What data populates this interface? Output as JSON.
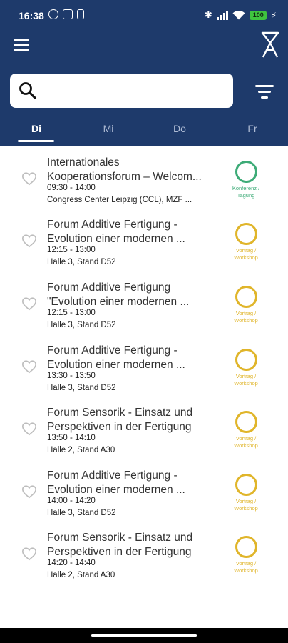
{
  "status_bar": {
    "time": "16:38",
    "battery": "100"
  },
  "header": {
    "menu_icon": "hamburger-menu-icon",
    "logo_icon": "leipzig-fair-logo-icon",
    "filter_icon": "filter-icon",
    "colors": {
      "background": "#1e3a6b",
      "accent": "#ffffff"
    }
  },
  "search": {
    "icon": "search-icon",
    "value": "",
    "placeholder": ""
  },
  "tabs": [
    {
      "label": "Di",
      "active": true
    },
    {
      "label": "Mi",
      "active": false
    },
    {
      "label": "Do",
      "active": false
    },
    {
      "label": "Fr",
      "active": false
    }
  ],
  "events": [
    {
      "title_line1": "Internationales",
      "title_line2": "Kooperationsforum – Welcom...",
      "time": "09:30 - 14:00",
      "location": " Congress Center Leipzig (CCL), MZF ...",
      "type_line1": "Konferenz /",
      "type_line2": "Tagung",
      "type_color": "#3dab77"
    },
    {
      "title_line1": "Forum Additive Fertigung -",
      "title_line2": "Evolution einer modernen ...",
      "time": "12:15 - 13:00",
      "location": "Halle 3, Stand D52",
      "type_line1": "Vortrag /",
      "type_line2": "Workshop",
      "type_color": "#e0b52a"
    },
    {
      "title_line1": "Forum Additive Fertigung",
      "title_line2": "\"Evolution einer modernen ...",
      "time": "12:15 - 13:00",
      "location": "Halle 3, Stand D52",
      "type_line1": "Vortrag /",
      "type_line2": "Workshop",
      "type_color": "#e0b52a"
    },
    {
      "title_line1": "Forum Additive Fertigung -",
      "title_line2": "Evolution einer modernen ...",
      "time": "13:30 - 13:50",
      "location": "Halle 3, Stand D52",
      "type_line1": "Vortrag /",
      "type_line2": "Workshop",
      "type_color": "#e0b52a"
    },
    {
      "title_line1": "Forum Sensorik - Einsatz und",
      "title_line2": "Perspektiven in der Fertigung",
      "time": "13:50 - 14:10",
      "location": "Halle 2, Stand A30",
      "type_line1": "Vortrag /",
      "type_line2": "Workshop",
      "type_color": "#e0b52a"
    },
    {
      "title_line1": "Forum Additive Fertigung -",
      "title_line2": "Evolution einer modernen ...",
      "time": "14:00 - 14:20",
      "location": "Halle 3, Stand D52",
      "type_line1": "Vortrag /",
      "type_line2": "Workshop",
      "type_color": "#e0b52a"
    },
    {
      "title_line1": "Forum Sensorik - Einsatz und",
      "title_line2": "Perspektiven in der Fertigung",
      "time": "14:20 - 14:40",
      "location": "Halle 2, Stand A30",
      "type_line1": "Vortrag /",
      "type_line2": "Workshop",
      "type_color": "#e0b52a"
    }
  ]
}
